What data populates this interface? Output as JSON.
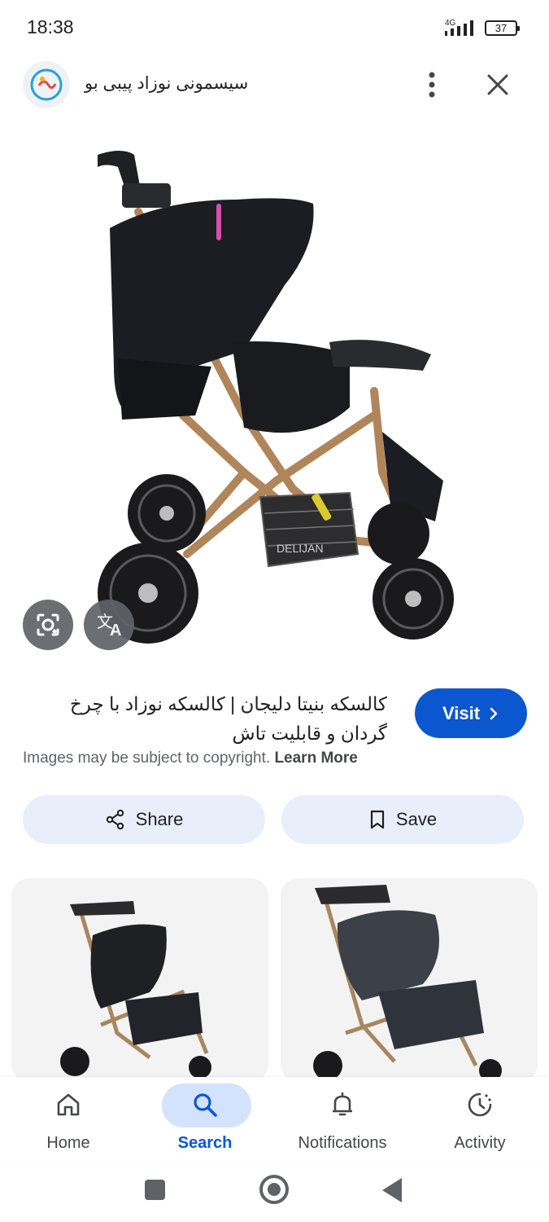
{
  "status_bar": {
    "time": "18:38",
    "network": "4G",
    "battery": "37"
  },
  "header": {
    "site_name": "سیسمونی نوزاد پیبی بو",
    "icons": [
      "site-logo-icon",
      "more-vert-icon",
      "close-icon"
    ]
  },
  "main_image": {
    "subject": "stroller-image",
    "brand_text": "DELIJAN"
  },
  "result": {
    "title": "کالسکه بنیتا دلیجان | کالسکه نوزاد با چرخ گردان و قابلیت تاش",
    "visit_label": "Visit",
    "copyright_text": "Images may be subject to copyright.",
    "learn_more_label": "Learn More"
  },
  "actions": {
    "share_label": "Share",
    "save_label": "Save"
  },
  "bottom_nav": {
    "items": [
      {
        "label": "Home",
        "icon": "home-icon"
      },
      {
        "label": "Search",
        "icon": "search-icon",
        "active": true
      },
      {
        "label": "Notifications",
        "icon": "bell-icon"
      },
      {
        "label": "Activity",
        "icon": "activity-icon"
      }
    ]
  },
  "colors": {
    "accent": "#0b57d0",
    "button_bg": "#e8effa",
    "nav_pill": "#d3e3fd"
  }
}
